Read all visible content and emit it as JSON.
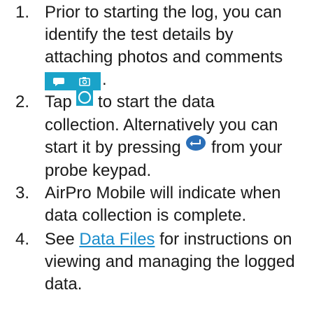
{
  "steps": [
    {
      "number": "1.",
      "line1": "Prior to starting the log, you can",
      "line2": "identify the test details by",
      "line3": "attaching photos and comments",
      "line4_tail": "."
    },
    {
      "number": "2.",
      "line1_pre": "Tap",
      "line1_post": "to start the data",
      "line2": "collection. Alternatively you can",
      "line3_pre": "start it by pressing",
      "line3_post": "from your",
      "line4": "probe keypad."
    },
    {
      "number": "3.",
      "line1": "AirPro Mobile will indicate when",
      "line2": "data collection is complete."
    },
    {
      "number": "4.",
      "line1_pre": "See",
      "link": "Data Files",
      "line1_post": "for instructions on",
      "line2": "viewing and managing the logged",
      "line3": "data."
    }
  ],
  "icons": {
    "comment": "comment-icon",
    "camera": "camera-icon",
    "record": "record-circle-icon",
    "enter": "enter-key-icon"
  },
  "colors": {
    "toolbar": "#1aa3c9",
    "link": "#1a8dcc",
    "enter_key": "#2a6fb8"
  }
}
